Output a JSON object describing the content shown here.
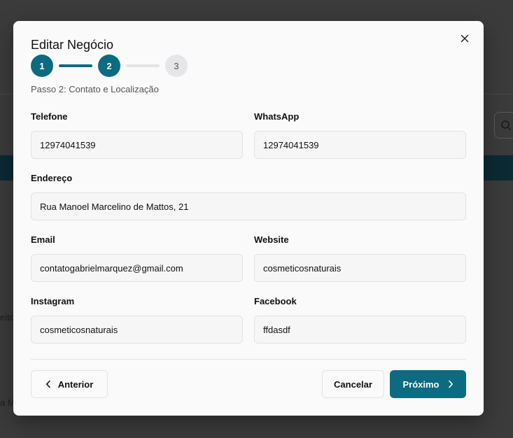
{
  "background": {
    "fragment_left_1": "eito",
    "fragment_left_2": "a M"
  },
  "modal": {
    "title": "Editar Negócio",
    "steps": [
      "1",
      "2",
      "3"
    ],
    "current_step": 2,
    "subtitle": "Passo 2: Contato e Localização"
  },
  "fields": {
    "telefone": {
      "label": "Telefone",
      "value": "12974041539"
    },
    "whatsapp": {
      "label": "WhatsApp",
      "value": "12974041539"
    },
    "endereco": {
      "label": "Endereço",
      "value": "Rua Manoel Marcelino de Mattos, 21"
    },
    "email": {
      "label": "Email",
      "value": "contatogabrielmarquez@gmail.com"
    },
    "website": {
      "label": "Website",
      "value": "cosmeticosnaturais"
    },
    "instagram": {
      "label": "Instagram",
      "value": "cosmeticosnaturais"
    },
    "facebook": {
      "label": "Facebook",
      "value": "ffdasdf"
    }
  },
  "footer": {
    "prev_label": "Anterior",
    "cancel_label": "Cancelar",
    "next_label": "Próximo"
  },
  "colors": {
    "accent": "#0c6b80",
    "overlay": "#3b3b3b"
  }
}
